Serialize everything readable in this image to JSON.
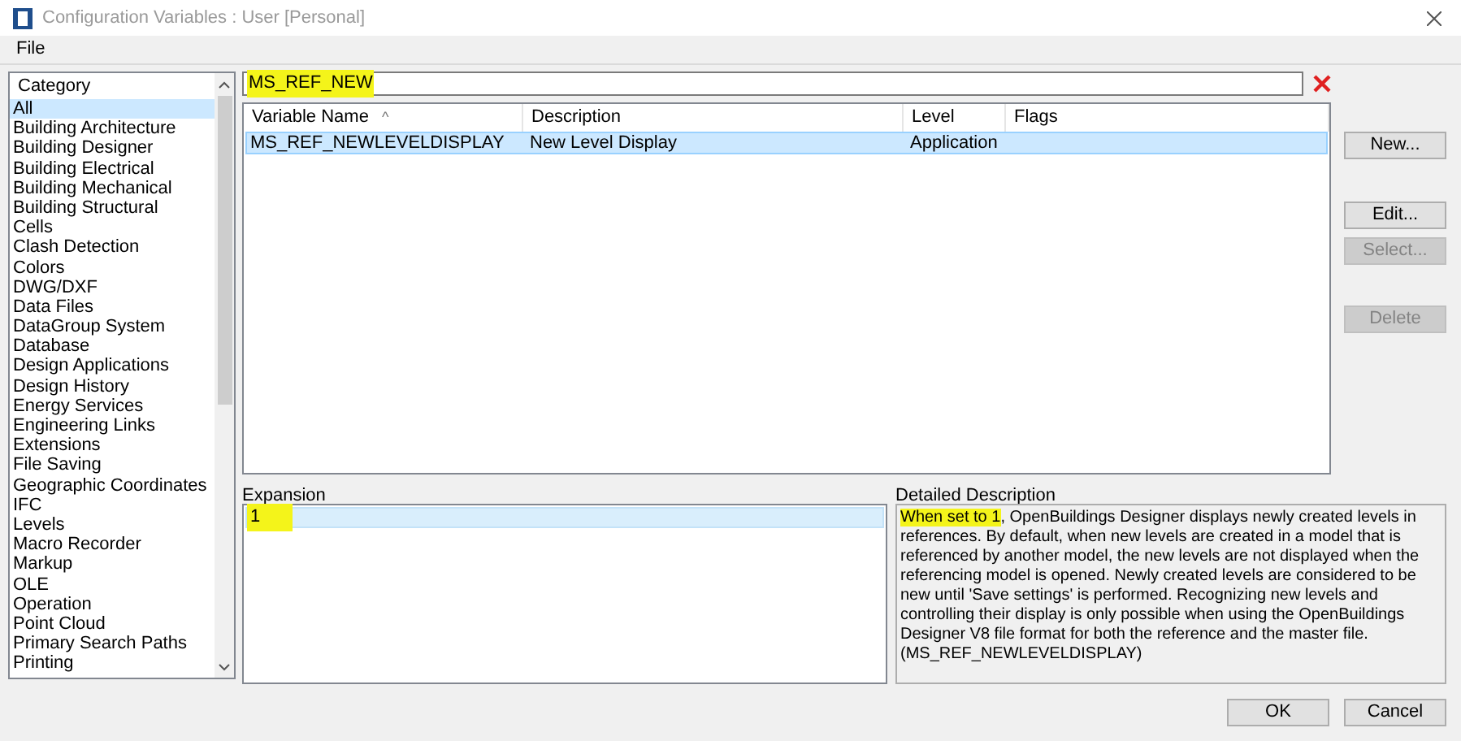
{
  "window": {
    "title": "Configuration Variables : User [Personal]"
  },
  "menu": [
    "File"
  ],
  "category_list": {
    "header": "Category",
    "items": [
      {
        "label": "All",
        "selected": true
      },
      {
        "label": "Building Architecture",
        "selected": false
      },
      {
        "label": "Building Designer",
        "selected": false
      },
      {
        "label": "Building Electrical",
        "selected": false
      },
      {
        "label": "Building Mechanical",
        "selected": false
      },
      {
        "label": "Building Structural",
        "selected": false
      },
      {
        "label": "Cells",
        "selected": false
      },
      {
        "label": "Clash Detection",
        "selected": false
      },
      {
        "label": "Colors",
        "selected": false
      },
      {
        "label": "DWG/DXF",
        "selected": false
      },
      {
        "label": "Data Files",
        "selected": false
      },
      {
        "label": "DataGroup System",
        "selected": false
      },
      {
        "label": "Database",
        "selected": false
      },
      {
        "label": "Design Applications",
        "selected": false
      },
      {
        "label": "Design History",
        "selected": false
      },
      {
        "label": "Energy Services",
        "selected": false
      },
      {
        "label": "Engineering Links",
        "selected": false
      },
      {
        "label": "Extensions",
        "selected": false
      },
      {
        "label": "File Saving",
        "selected": false
      },
      {
        "label": "Geographic Coordinates",
        "selected": false
      },
      {
        "label": "IFC",
        "selected": false
      },
      {
        "label": "Levels",
        "selected": false
      },
      {
        "label": "Macro Recorder",
        "selected": false
      },
      {
        "label": "Markup",
        "selected": false
      },
      {
        "label": "OLE",
        "selected": false
      },
      {
        "label": "Operation",
        "selected": false
      },
      {
        "label": "Point Cloud",
        "selected": false
      },
      {
        "label": "Primary Search Paths",
        "selected": false
      },
      {
        "label": "Printing",
        "selected": false
      }
    ]
  },
  "search": {
    "value": "MS_REF_NEW",
    "highlighted": true
  },
  "table": {
    "columns": [
      {
        "label": "Variable Name",
        "sort_indicator": "^"
      },
      {
        "label": "Description"
      },
      {
        "label": "Level"
      },
      {
        "label": "Flags"
      }
    ],
    "rows": [
      {
        "cells": [
          "MS_REF_NEWLEVELDISPLAY",
          "New Level Display",
          "Application",
          ""
        ],
        "selected": true
      }
    ]
  },
  "side_buttons": [
    {
      "label": "New...",
      "disabled": false
    },
    {
      "label": "Edit...",
      "disabled": false
    },
    {
      "label": "Select...",
      "disabled": true
    },
    {
      "label": "Delete",
      "disabled": true
    }
  ],
  "expansion": {
    "label": "Expansion",
    "value": "1",
    "highlighted": true
  },
  "detailed_description": {
    "label": "Detailed Description",
    "highlighted_part": "When set to 1",
    "rest": ", OpenBuildings Designer displays newly created levels in references. By default, when new levels are created in a model that is referenced by another model, the new levels are not displayed when the referencing model is opened. Newly created levels are considered to be new until 'Save settings' is performed. Recognizing new levels and controlling their display is only possible when using the OpenBuildings Designer V8 file format for both the reference and the master file. (MS_REF_NEWLEVELDISPLAY)"
  },
  "buttons": [
    "OK",
    "Cancel"
  ]
}
